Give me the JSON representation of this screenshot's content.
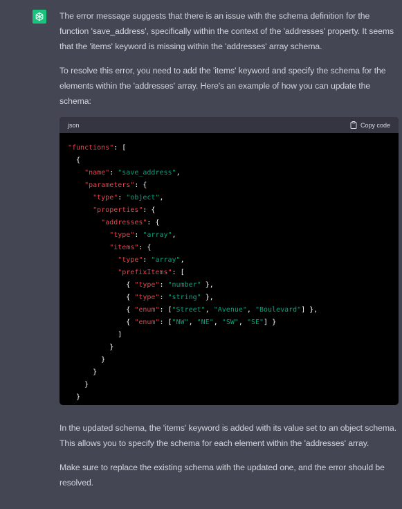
{
  "assistant": {
    "avatar_icon": "openai-logo-icon",
    "avatar_color": "#19c37d"
  },
  "message": {
    "paragraphs_before": [
      "The error message suggests that there is an issue with the schema definition for the function 'save_address', specifically within the context of the 'addresses' property. It seems that the 'items' keyword is missing within the 'addresses' array schema.",
      "To resolve this error, you need to add the 'items' keyword and specify the schema for the elements within the 'addresses' array. Here's an example of how you can update the schema:"
    ],
    "code_block": {
      "language": "json",
      "copy_label": "Copy code",
      "copy_icon": "clipboard-icon",
      "lines": [
        "\"functions\": [",
        "  {",
        "    \"name\": \"save_address\",",
        "    \"parameters\": {",
        "      \"type\": \"object\",",
        "      \"properties\": {",
        "        \"addresses\": {",
        "          \"type\": \"array\",",
        "          \"items\": {",
        "            \"type\": \"array\",",
        "            \"prefixItems\": [",
        "              { \"type\": \"number\" },",
        "              { \"type\": \"string\" },",
        "              { \"enum\": [\"Street\", \"Avenue\", \"Boulevard\"] },",
        "              { \"enum\": [\"NW\", \"NE\", \"SW\", \"SE\"] }",
        "            ]",
        "          }",
        "        }",
        "      }",
        "    }",
        "  }",
        "]"
      ]
    },
    "paragraphs_after": [
      "In the updated schema, the 'items' keyword is added with its value set to an object schema. This allows you to specify the schema for each element within the 'addresses' array.",
      "Make sure to replace the existing schema with the updated one, and the error should be resolved."
    ]
  }
}
